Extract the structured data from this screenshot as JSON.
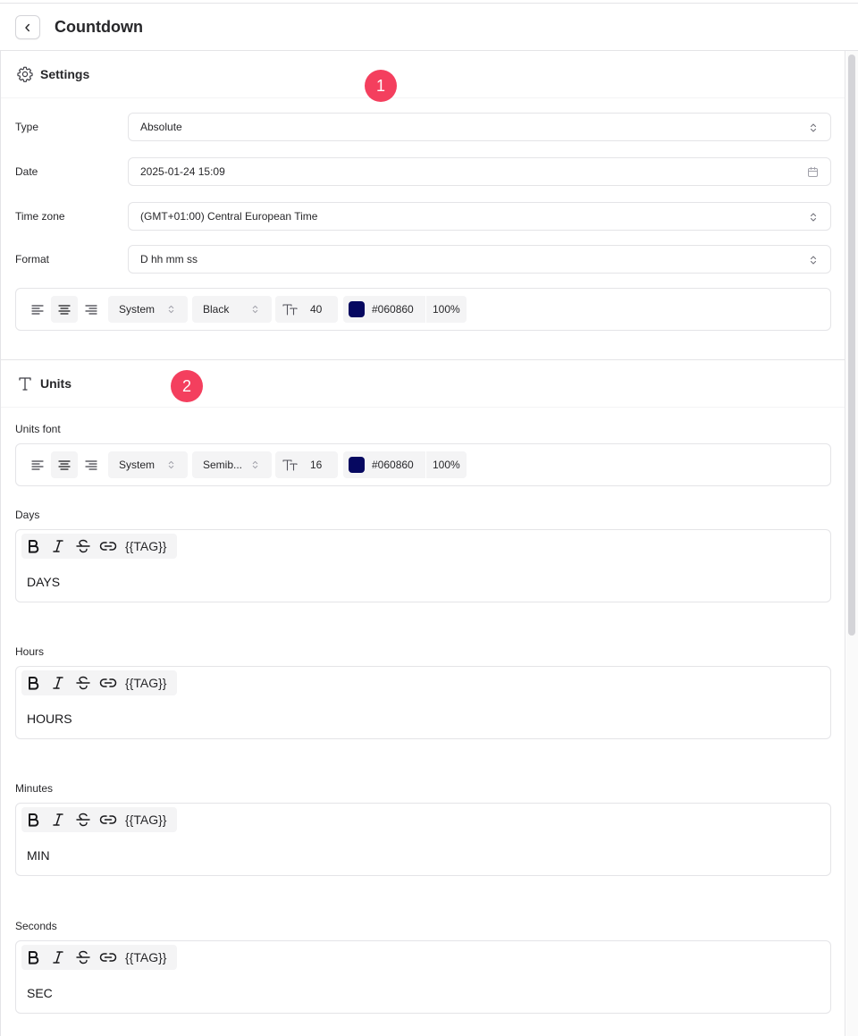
{
  "header": {
    "title": "Countdown"
  },
  "settings": {
    "title": "Settings",
    "badge": "1",
    "rows": {
      "type": {
        "label": "Type",
        "value": "Absolute"
      },
      "date": {
        "label": "Date",
        "value": "2025-01-24 15:09"
      },
      "timezone": {
        "label": "Time zone",
        "value": "(GMT+01:00) Central European Time"
      },
      "format": {
        "label": "Format",
        "value": "D hh mm ss"
      }
    },
    "font": {
      "alignment": "center",
      "family": "System",
      "weight": "Black",
      "size": "40",
      "color_hex": "#060860",
      "opacity": "100%"
    }
  },
  "units": {
    "title": "Units",
    "badge": "2",
    "font_label": "Units font",
    "font": {
      "alignment": "center",
      "family": "System",
      "weight": "Semib...",
      "size": "16",
      "color_hex": "#060860",
      "opacity": "100%"
    },
    "tag_label": "{{TAG}}",
    "fields": [
      {
        "label": "Days",
        "value": "DAYS"
      },
      {
        "label": "Hours",
        "value": "HOURS"
      },
      {
        "label": "Minutes",
        "value": "MIN"
      },
      {
        "label": "Seconds",
        "value": "SEC"
      }
    ]
  },
  "colors": {
    "badge": "#f43f5e",
    "swatch": "#060860",
    "border": "#e4e4e7"
  },
  "icons": {
    "back": "chevron-left-icon",
    "settings": "gear-icon",
    "units": "text-t-icon",
    "select": "chevron-up-down-icon",
    "date": "calendar-icon",
    "font_size": "font-size-icon"
  }
}
